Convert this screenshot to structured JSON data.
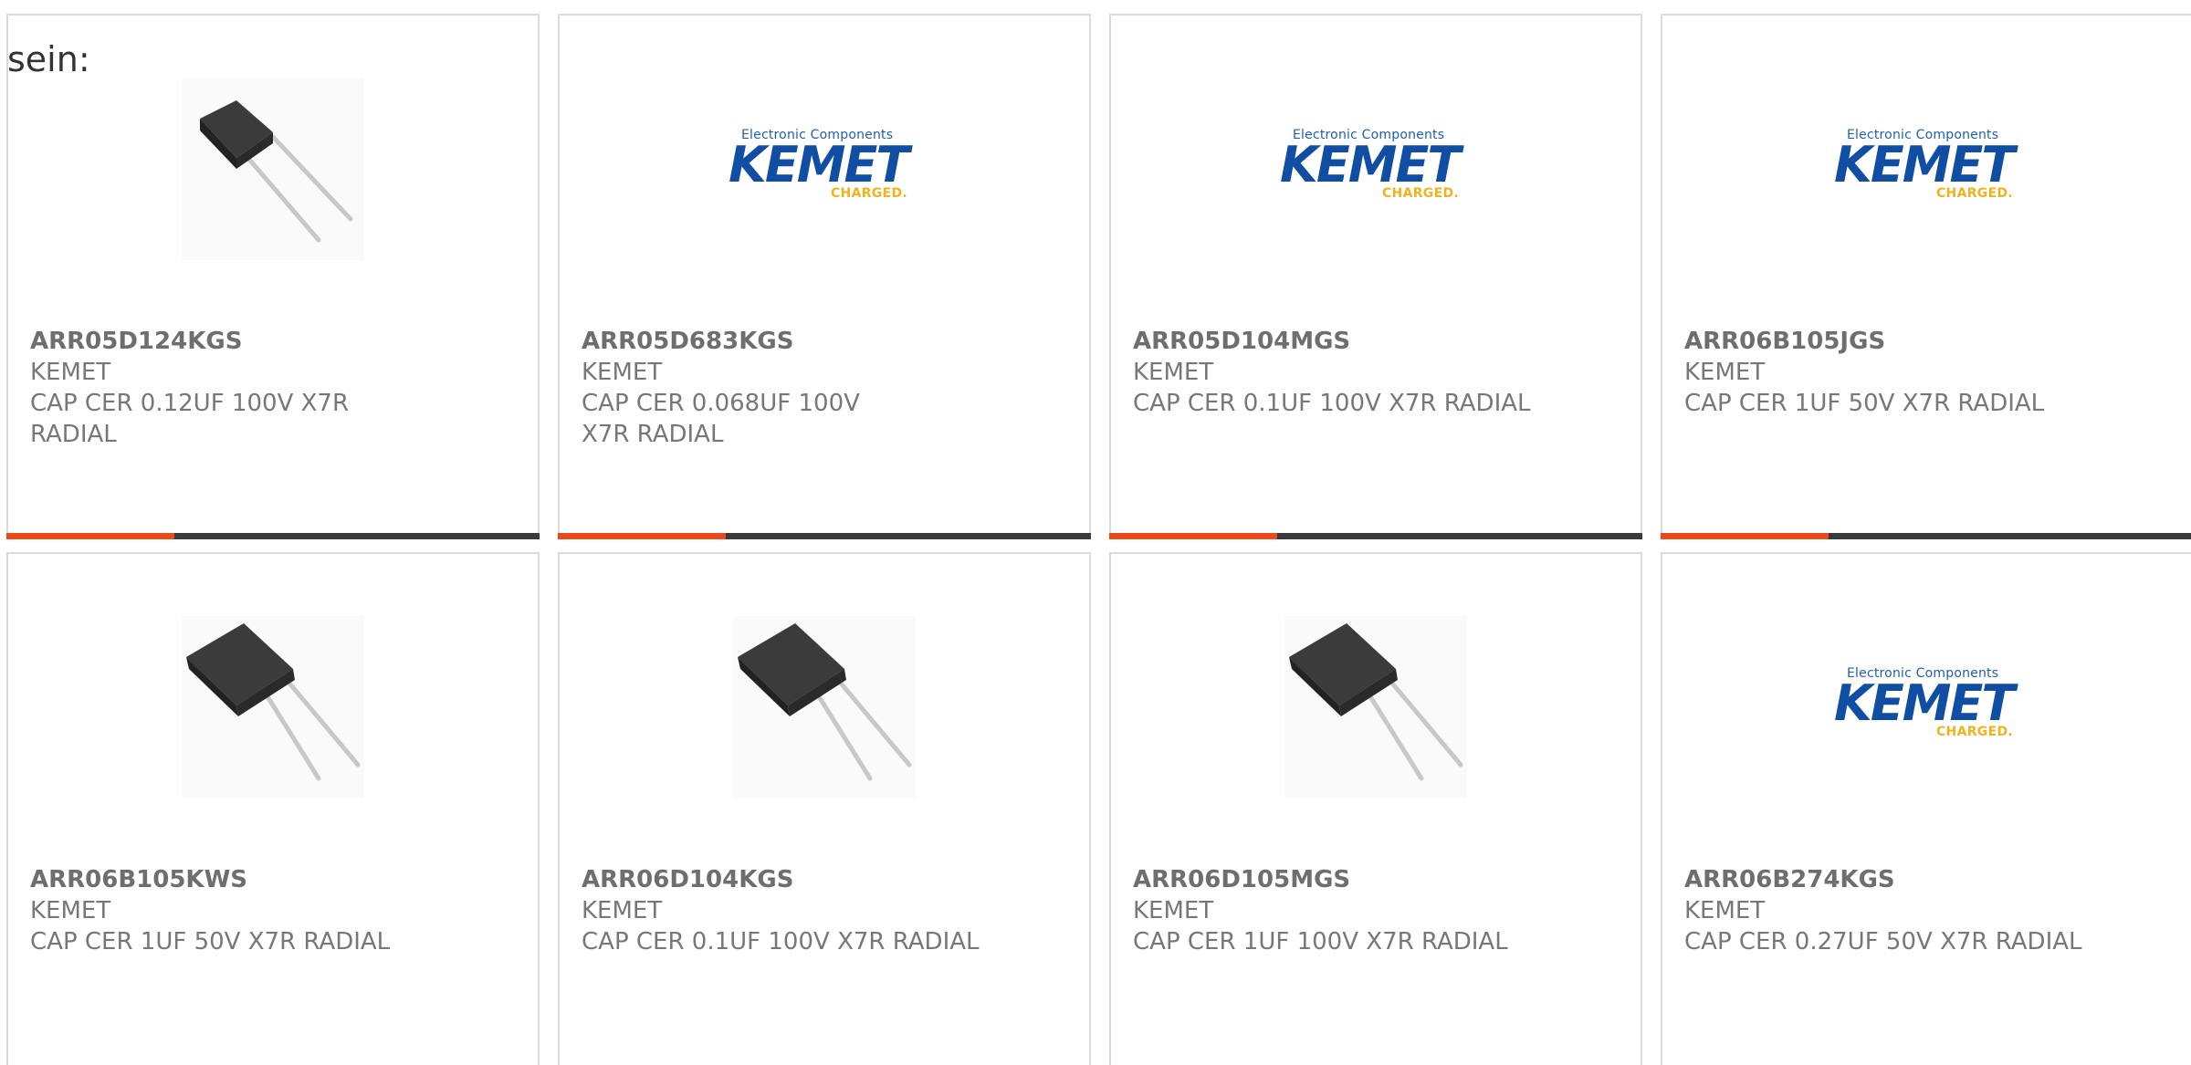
{
  "leading_text": "sein:",
  "logo_text": {
    "tagline": "Electronic Components",
    "wordmark": "KEMET",
    "sub": "CHARGED."
  },
  "colors": {
    "accent_bar": "#e84a1b",
    "dark_bar": "#3a3a3a",
    "logo_blue": "#0f4ea2",
    "logo_yellow": "#f2b21b",
    "card_border": "#dcdcdc",
    "text": "#777777"
  },
  "products": [
    {
      "part_number": "ARR05D124KGS",
      "manufacturer": "KEMET",
      "description": "CAP CER 0.12UF 100V X7R RADIAL",
      "image": "capacitor-photo",
      "has_bar": true
    },
    {
      "part_number": "ARR05D683KGS",
      "manufacturer": "KEMET",
      "description": "CAP CER 0.068UF 100V X7R RADIAL",
      "image": "kemet-logo",
      "has_bar": true
    },
    {
      "part_number": "ARR05D104MGS",
      "manufacturer": "KEMET",
      "description": "CAP CER 0.1UF 100V X7R RADIAL",
      "image": "kemet-logo",
      "has_bar": true
    },
    {
      "part_number": "ARR06B105JGS",
      "manufacturer": "KEMET",
      "description": "CAP CER 1UF 50V X7R RADIAL",
      "image": "kemet-logo",
      "has_bar": true
    },
    {
      "part_number": "ARR06B105KWS",
      "manufacturer": "KEMET",
      "description": "CAP CER 1UF 50V X7R RADIAL",
      "image": "capacitor-photo",
      "has_bar": false
    },
    {
      "part_number": "ARR06D104KGS",
      "manufacturer": "KEMET",
      "description": "CAP CER 0.1UF 100V X7R RADIAL",
      "image": "capacitor-photo",
      "has_bar": false
    },
    {
      "part_number": "ARR06D105MGS",
      "manufacturer": "KEMET",
      "description": "CAP CER 1UF 100V X7R RADIAL",
      "image": "capacitor-photo",
      "has_bar": false
    },
    {
      "part_number": "ARR06B274KGS",
      "manufacturer": "KEMET",
      "description": "CAP CER 0.27UF 50V X7R RADIAL",
      "image": "kemet-logo",
      "has_bar": false
    }
  ]
}
